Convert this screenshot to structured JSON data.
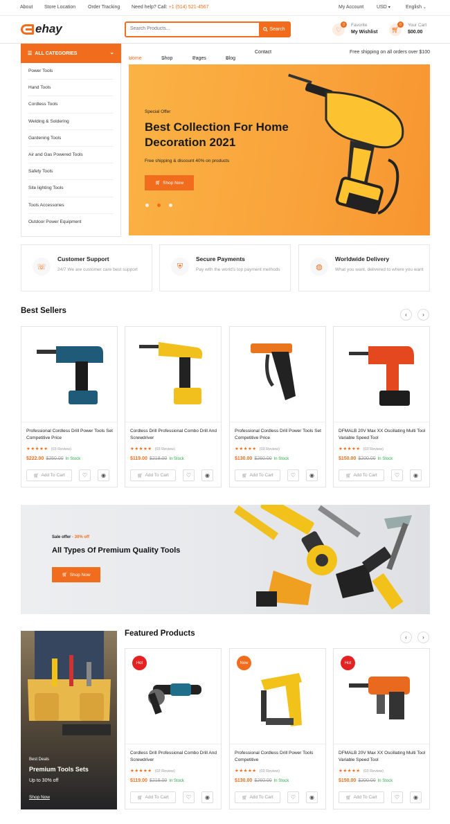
{
  "topbar": {
    "about": "About",
    "store_location": "Store Location",
    "order_tracking": "Order Tracking",
    "help_label": "Need help? Call:",
    "phone": "+1 (514) 521-4567",
    "my_account": "My Account",
    "currency": "USD",
    "language": "English"
  },
  "header": {
    "logo": "ehay",
    "search_placeholder": "Search Products...",
    "search_button": "Search",
    "wishlist_count": "0",
    "wishlist_top": "Favorite",
    "wishlist_label": "My Wishlist",
    "cart_count": "0",
    "cart_top": "Your Cart",
    "cart_total": "$00.00"
  },
  "categories": {
    "title": "ALL CATEGORIES",
    "items": [
      "Power Tools",
      "Hand Tools",
      "Cordless Tools",
      "Welding & Soldering",
      "Gardening Tools",
      "Air and Gas Powered Tools",
      "Safety Tools",
      "Site lighting Tools",
      "Tools Accessories",
      "Outdoor Power Equipment"
    ]
  },
  "nav": {
    "items": [
      "Home",
      "Shop",
      "Pages",
      "Blog",
      "Contact"
    ],
    "shipping_note": "Free shipping on all orders over $100"
  },
  "hero": {
    "kicker": "Special Offer",
    "title": "Best Collection For Home Decoration 2021",
    "subtitle": "Free shipping & discount 40% on products",
    "cta": "Shop Now"
  },
  "features": [
    {
      "title": "Customer Support",
      "desc": "24/7 We are customer care best support"
    },
    {
      "title": "Secure Payments",
      "desc": "Pay with the world's top payment methods"
    },
    {
      "title": "Worldwide Delivery",
      "desc": "What you want, delivered to where you want"
    }
  ],
  "best_sellers": {
    "title": "Best Sellers",
    "products": [
      {
        "name": "Professional Cordless Drill Power Tools Set Competitive Price",
        "reviews": "(03 Review)",
        "price": "$222.00",
        "old_price": "$250.00",
        "stock": "In Stock"
      },
      {
        "name": "Cordless Drill Professional Combo Drill And Screwdriver",
        "reviews": "(03 Review)",
        "price": "$119.00",
        "old_price": "$219.00",
        "stock": "In Stock"
      },
      {
        "name": "Professional Cordless Drill Power Tools Set Competitive Price",
        "reviews": "(03 Review)",
        "price": "$130.00",
        "old_price": "$260.00",
        "stock": "In Stock"
      },
      {
        "name": "DFMALB 20V Max XX Oscillating Multi Tool Variable Speed Tool",
        "reviews": "(03 Review)",
        "price": "$150.00",
        "old_price": "$200.00",
        "stock": "In Stock"
      }
    ]
  },
  "add_to_cart": "Add To Cart",
  "stars": "★★★★★",
  "banner": {
    "kicker": "Sale offer",
    "discount": "- 30% off",
    "title": "All Types Of Premium Quality Tools",
    "cta": "Shop Now"
  },
  "promo": {
    "kicker": "Best Deals",
    "title": "Premium Tools Sets",
    "subtitle": "Up to 30% off",
    "link": "Shop Now"
  },
  "featured": {
    "title": "Featured Products",
    "products": [
      {
        "tag": "Hot",
        "tag_color": "#e52222",
        "name": "Cordless Drill Professional Combo Drill And Screwdriver",
        "reviews": "(03 Review)",
        "price": "$119.00",
        "old_price": "$219.00",
        "stock": "In Stock"
      },
      {
        "tag": "New",
        "tag_color": "#f26c1d",
        "name": "Professional Cordless Drill Power Tools Competitive",
        "reviews": "(03 Review)",
        "price": "$130.00",
        "old_price": "$260.00",
        "stock": "In Stock"
      },
      {
        "tag": "Hot",
        "tag_color": "#e52222",
        "name": "DFMALB 20V Max XX Oscillating Multi Tool Variable Speed Tool",
        "reviews": "(03 Review)",
        "price": "$150.00",
        "old_price": "$200.00",
        "stock": "In Stock"
      }
    ]
  },
  "colors": {
    "accent": "#f26c1d",
    "hot": "#e52222",
    "in_stock": "#2eaa4d"
  }
}
